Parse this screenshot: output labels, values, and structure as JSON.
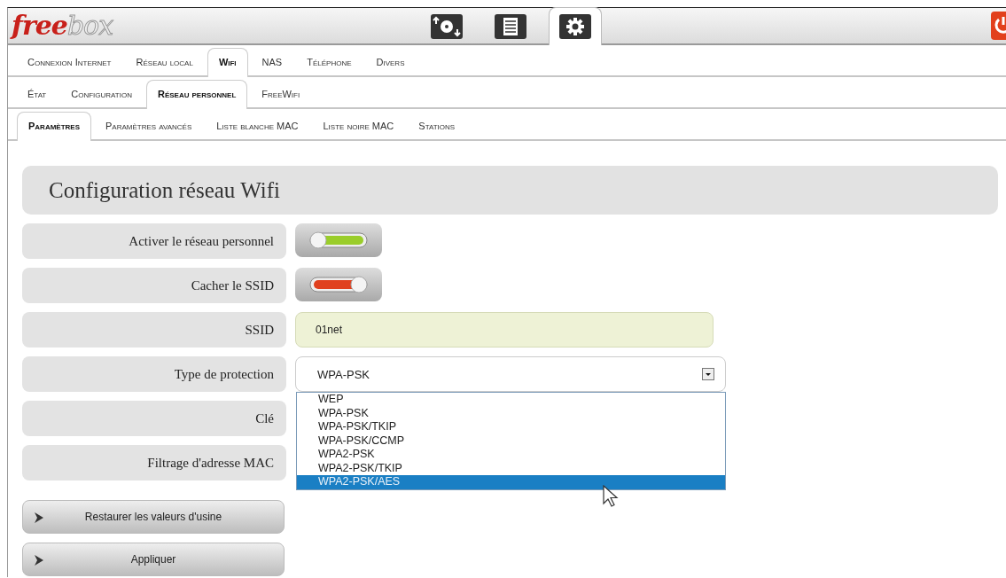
{
  "header": {
    "logo": {
      "first": "free",
      "second": "box"
    },
    "toolbar": [
      {
        "kind": "transfers",
        "selected": false
      },
      {
        "kind": "list",
        "selected": false
      },
      {
        "kind": "settings",
        "selected": true
      }
    ],
    "power": {
      "kind": "power"
    }
  },
  "tab_rows": [
    [
      {
        "label": "Connexion Internet",
        "selected": false
      },
      {
        "label": "Réseau local",
        "selected": false
      },
      {
        "label": "Wifi",
        "selected": true
      },
      {
        "label": "NAS",
        "selected": false
      },
      {
        "label": "Téléphone",
        "selected": false
      },
      {
        "label": "Divers",
        "selected": false
      }
    ],
    [
      {
        "label": "État",
        "selected": false
      },
      {
        "label": "Configuration",
        "selected": false
      },
      {
        "label": "Réseau personnel",
        "selected": true
      },
      {
        "label": "FreeWifi",
        "selected": false
      }
    ],
    [
      {
        "label": "Paramètres",
        "selected": true
      },
      {
        "label": "Paramètres avancés",
        "selected": false
      },
      {
        "label": "Liste blanche MAC",
        "selected": false
      },
      {
        "label": "Liste noire MAC",
        "selected": false
      },
      {
        "label": "Stations",
        "selected": false
      }
    ]
  ],
  "panel": {
    "title": "Configuration réseau Wifi",
    "rows": [
      {
        "label": "Activer le réseau personnel",
        "kind": "toggle",
        "on": true
      },
      {
        "label": "Cacher le SSID",
        "kind": "toggle",
        "on": false
      },
      {
        "label": "SSID",
        "kind": "text",
        "value": "01net"
      },
      {
        "label": "Type de protection",
        "kind": "select",
        "value": "WPA-PSK",
        "expanded": true,
        "options": [
          {
            "label": "WEP",
            "highlighted": false
          },
          {
            "label": "WPA-PSK",
            "highlighted": false
          },
          {
            "label": "WPA-PSK/TKIP",
            "highlighted": false
          },
          {
            "label": "WPA-PSK/CCMP",
            "highlighted": false
          },
          {
            "label": "WPA2-PSK",
            "highlighted": false
          },
          {
            "label": "WPA2-PSK/TKIP",
            "highlighted": false
          },
          {
            "label": "WPA2-PSK/AES",
            "highlighted": true
          }
        ]
      },
      {
        "label": "Clé",
        "kind": "covered"
      },
      {
        "label": "Filtrage d'adresse MAC",
        "kind": "covered"
      }
    ],
    "buttons": [
      "Restaurer les valeurs d'usine",
      "Appliquer"
    ]
  }
}
